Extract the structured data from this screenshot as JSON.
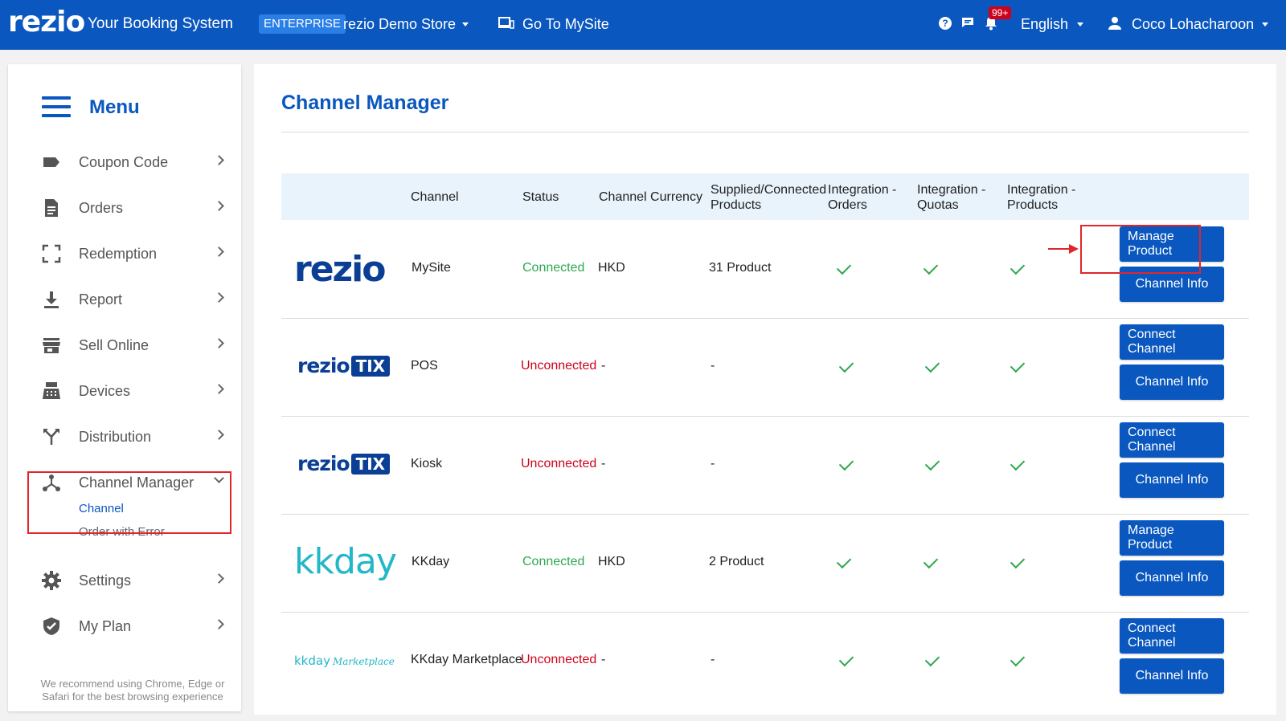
{
  "header": {
    "logo": "rezio",
    "system_title": "Your Booking System",
    "plan_badge": "ENTERPRISE",
    "store_name": "rezio Demo Store",
    "site_link": "Go To MySite",
    "notification_count": "99+",
    "language": "English",
    "user_name": "Coco Lohacharoon",
    "help_icon": "?"
  },
  "sidebar": {
    "menu_title": "Menu",
    "items": [
      {
        "label": "Coupon Code",
        "icon": "tag-icon"
      },
      {
        "label": "Orders",
        "icon": "document-icon"
      },
      {
        "label": "Redemption",
        "icon": "scan-icon"
      },
      {
        "label": "Report",
        "icon": "download-icon"
      },
      {
        "label": "Sell Online",
        "icon": "store-icon"
      },
      {
        "label": "Devices",
        "icon": "register-icon"
      },
      {
        "label": "Distribution",
        "icon": "split-icon"
      },
      {
        "label": "Channel Manager",
        "icon": "hub-icon",
        "expanded": true,
        "sub_items": [
          {
            "label": "Channel",
            "active": true
          },
          {
            "label": "Order with Error",
            "active": false
          }
        ]
      },
      {
        "label": "Settings",
        "icon": "gear-icon"
      },
      {
        "label": "My Plan",
        "icon": "shield-icon"
      }
    ],
    "recommendation": "We recommend using Chrome, Edge or Safari for the best browsing experience"
  },
  "main": {
    "page_title": "Channel Manager",
    "table": {
      "headers": {
        "channel": "Channel",
        "status": "Status",
        "currency": "Channel Currency",
        "products": "Supplied/Connected Products",
        "int_orders": "Integration - Orders",
        "int_quotas": "Integration - Quotas",
        "int_products": "Integration - Products"
      },
      "rows": [
        {
          "logo_text": "rezio",
          "channel": "MySite",
          "status": "Connected",
          "currency": "HKD",
          "products": "31 Product",
          "btn1": "Manage Product",
          "btn2": "Channel Info"
        },
        {
          "logo_text": "rezio",
          "logo_tag": "TIX",
          "channel": "POS",
          "status": "Unconnected",
          "currency": "-",
          "products": "-",
          "btn1": "Connect Channel",
          "btn2": "Channel Info"
        },
        {
          "logo_text": "rezio",
          "logo_tag": "TIX",
          "channel": "Kiosk",
          "status": "Unconnected",
          "currency": "-",
          "products": "-",
          "btn1": "Connect Channel",
          "btn2": "Channel Info"
        },
        {
          "logo_text": "kkday",
          "channel": "KKday",
          "status": "Connected",
          "currency": "HKD",
          "products": "2 Product",
          "btn1": "Manage Product",
          "btn2": "Channel Info"
        },
        {
          "logo_text": "kkday",
          "logo_tag": "Marketplace",
          "channel": "KKday Marketplace",
          "status": "Unconnected",
          "currency": "-",
          "products": "-",
          "btn1": "Connect Channel",
          "btn2": "Channel Info"
        }
      ]
    }
  },
  "colors": {
    "brand": "#0a57bf",
    "connected": "#2fa84f",
    "unconnected": "#d0021b",
    "highlight": "#e0262a"
  }
}
